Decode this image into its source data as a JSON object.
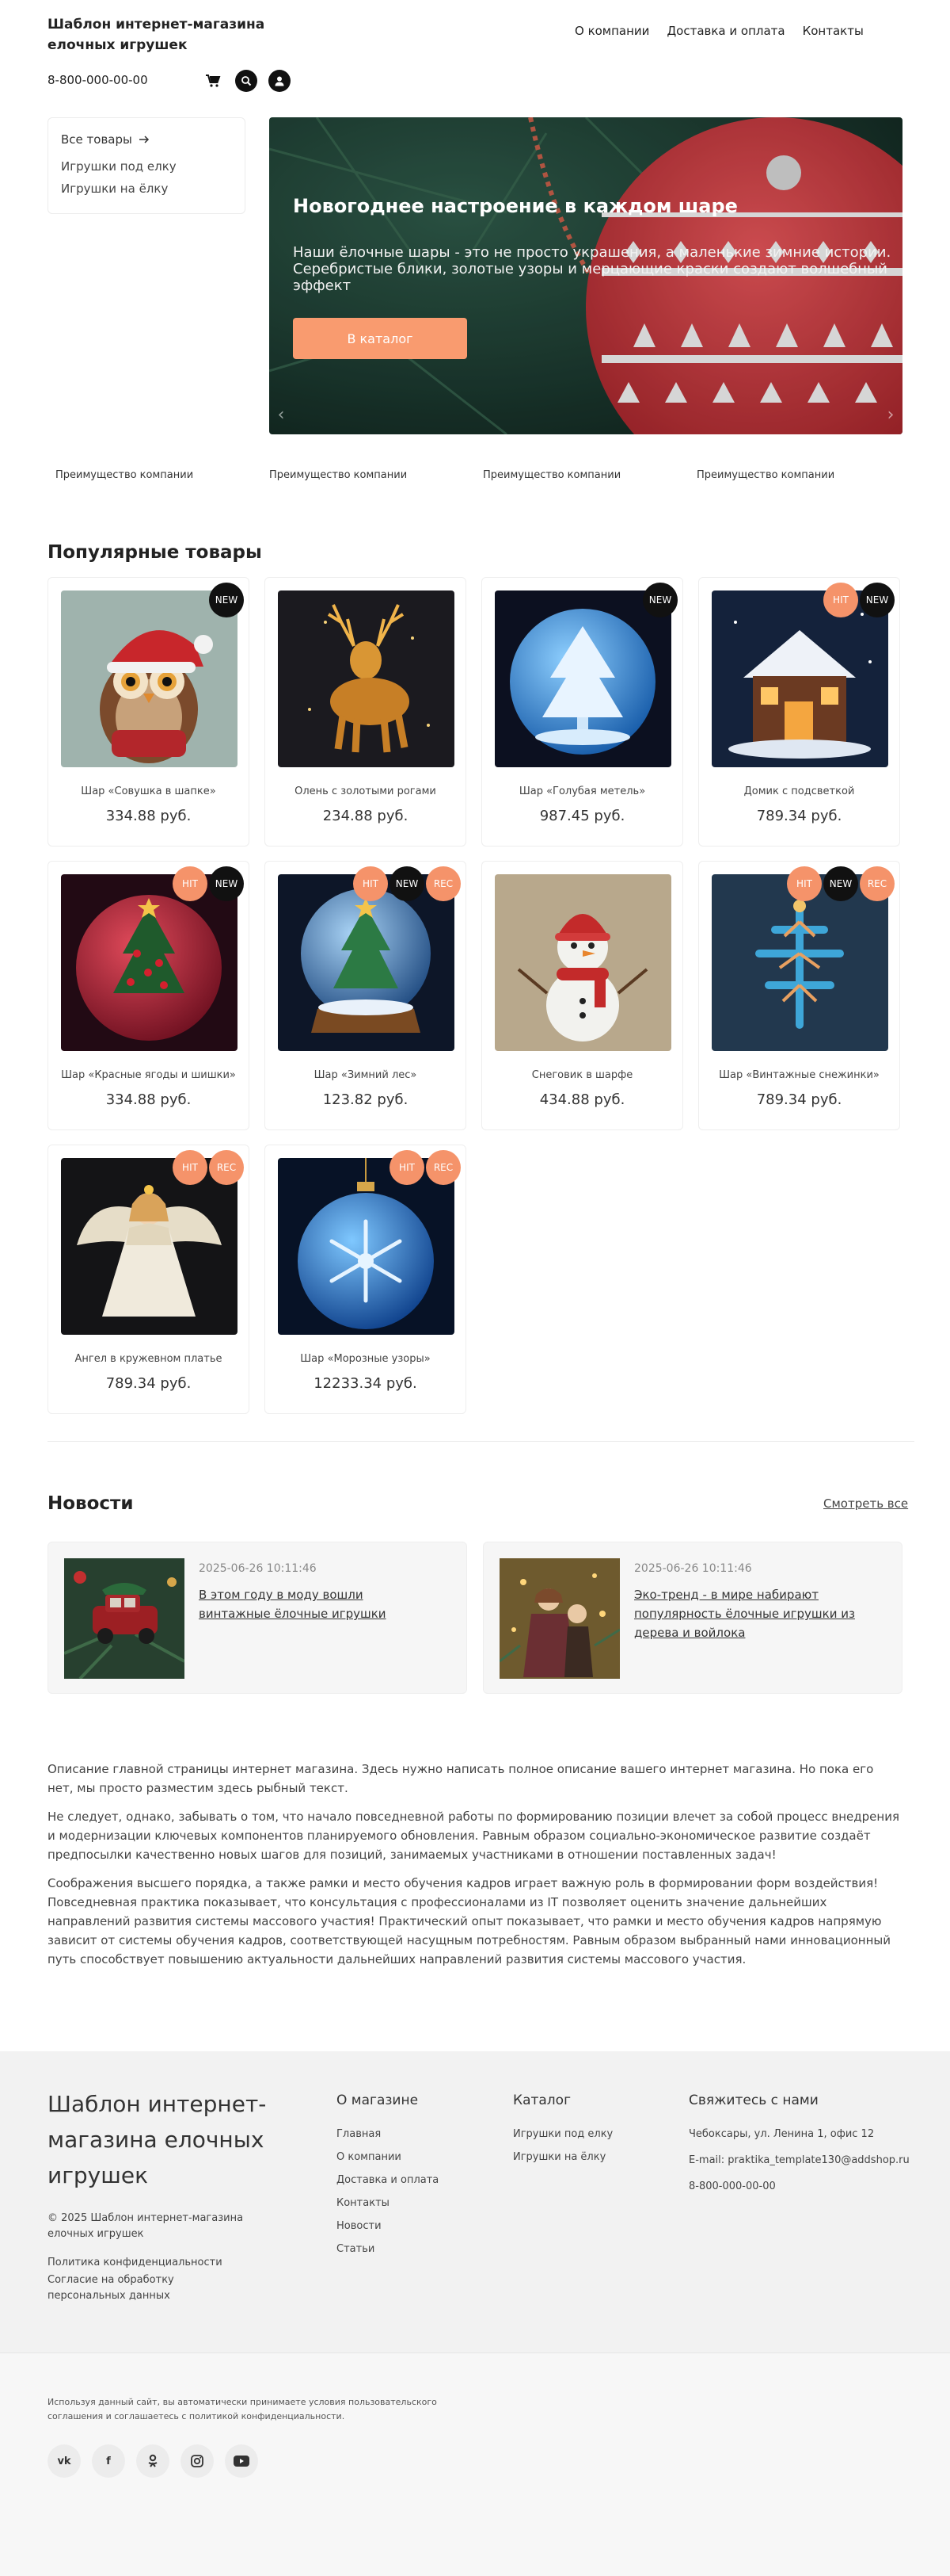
{
  "header": {
    "site_title": "Шаблон интернет-магазина елочных игрушек",
    "nav": [
      "О компании",
      "Доставка и оплата",
      "Контакты"
    ],
    "phone": "8-800-000-00-00",
    "icons": [
      "cart-icon",
      "search-icon",
      "user-icon"
    ]
  },
  "catalog_menu": {
    "all_label": "Все товары",
    "items": [
      "Игрушки под елку",
      "Игрушки на ёлку"
    ]
  },
  "banner": {
    "title": "Новогоднее настроение в каждом шаре",
    "text": "Наши ёлочные шары - это не просто украшения, а маленькие зимние истории. Серебристые блики, золотые узоры и мерцающие краски создают волшебный эффект",
    "button": "В каталог",
    "accent_color": "#f99b6f"
  },
  "advantages": [
    "Преимущество компании",
    "Преимущество компании",
    "Преимущество компании",
    "Преимущество компании"
  ],
  "popular": {
    "title": "Популярные товары",
    "products": [
      {
        "name": "Шар «Совушка в шапке»",
        "price": "334.88 руб.",
        "badges": [
          "NEW"
        ]
      },
      {
        "name": "Олень с золотыми рогами",
        "price": "234.88 руб.",
        "badges": []
      },
      {
        "name": "Шар «Голубая метель»",
        "price": "987.45 руб.",
        "badges": [
          "NEW"
        ]
      },
      {
        "name": "Домик с подсветкой",
        "price": "789.34 руб.",
        "badges": [
          "HIT",
          "NEW"
        ]
      },
      {
        "name": "Шар «Красные ягоды и шишки»",
        "price": "334.88 руб.",
        "badges": [
          "HIT",
          "NEW"
        ]
      },
      {
        "name": "Шар «Зимний лес»",
        "price": "123.82 руб.",
        "badges": [
          "HIT",
          "NEW",
          "REC"
        ]
      },
      {
        "name": "Снеговик в шарфе",
        "price": "434.88 руб.",
        "badges": []
      },
      {
        "name": "Шар «Винтажные снежинки»",
        "price": "789.34 руб.",
        "badges": [
          "HIT",
          "NEW",
          "REC"
        ]
      },
      {
        "name": "Ангел в кружевном платье",
        "price": "789.34 руб.",
        "badges": [
          "HIT",
          "REC"
        ]
      },
      {
        "name": "Шар «Морозные узоры»",
        "price": "12233.34 руб.",
        "badges": [
          "HIT",
          "REC"
        ]
      }
    ]
  },
  "news": {
    "title": "Новости",
    "see_all": "Смотреть все",
    "items": [
      {
        "date": "2025-06-26 10:11:46",
        "title": "В этом году в моду вошли винтажные ёлочные игрушки"
      },
      {
        "date": "2025-06-26 10:11:46",
        "title": "Эко-тренд - в мире набирают популярность ёлочные игрушки из дерева и войлока"
      }
    ]
  },
  "description": [
    "Описание главной страницы интернет магазина. Здесь нужно написать полное описание вашего интернет магазина. Но пока его нет, мы просто разместим здесь рыбный текст.",
    "Не следует, однако, забывать о том, что начало повседневной работы по формированию позиции влечет за собой процесс внедрения и модернизации ключевых компонентов планируемого обновления. Равным образом социально-экономическое развитие создаёт предпосылки качественно новых шагов для позиций, занимаемых участниками в отношении поставленных задач!",
    "Соображения высшего порядка, а также рамки и место обучения кадров играет важную роль в формировании форм воздействия! Повседневная практика показывает, что консультация с профессионалами из IT позволяет оценить значение дальнейших направлений развития системы массового участия! Практический опыт показывает, что рамки и место обучения кадров напрямую зависит от системы обучения кадров, соответствующей насущным потребностям. Равным образом выбранный нами инновационный путь способствует повышению актуальности дальнейших направлений развития системы массового участия."
  ],
  "footer": {
    "title": "Шаблон интернет-магазина елочных игрушек",
    "copyright": "© 2025 Шаблон интернет-магазина елочных игрушек",
    "privacy": "Политика конфиденциальности",
    "consent": "Согласие на обработку персональных данных",
    "about_title": "О магазине",
    "about_links": [
      "Главная",
      "О компании",
      "Доставка и оплата",
      "Контакты",
      "Новости",
      "Статьи"
    ],
    "catalog_title": "Каталог",
    "catalog_links": [
      "Игрушки под елку",
      "Игрушки на ёлку"
    ],
    "contact_title": "Свяжитесь с нами",
    "address": "Чебоксары, ул. Ленина 1, офис 12",
    "email": "E-mail: praktika_template130@addshop.ru",
    "phone": "8-800-000-00-00",
    "legal": "Используя данный сайт, вы автоматически принимаете условия пользовательского соглашения и соглашаетесь с политикой конфиденциальности.",
    "socials": [
      "vk-icon",
      "facebook-icon",
      "odnoklassniki-icon",
      "instagram-icon",
      "youtube-icon"
    ]
  }
}
